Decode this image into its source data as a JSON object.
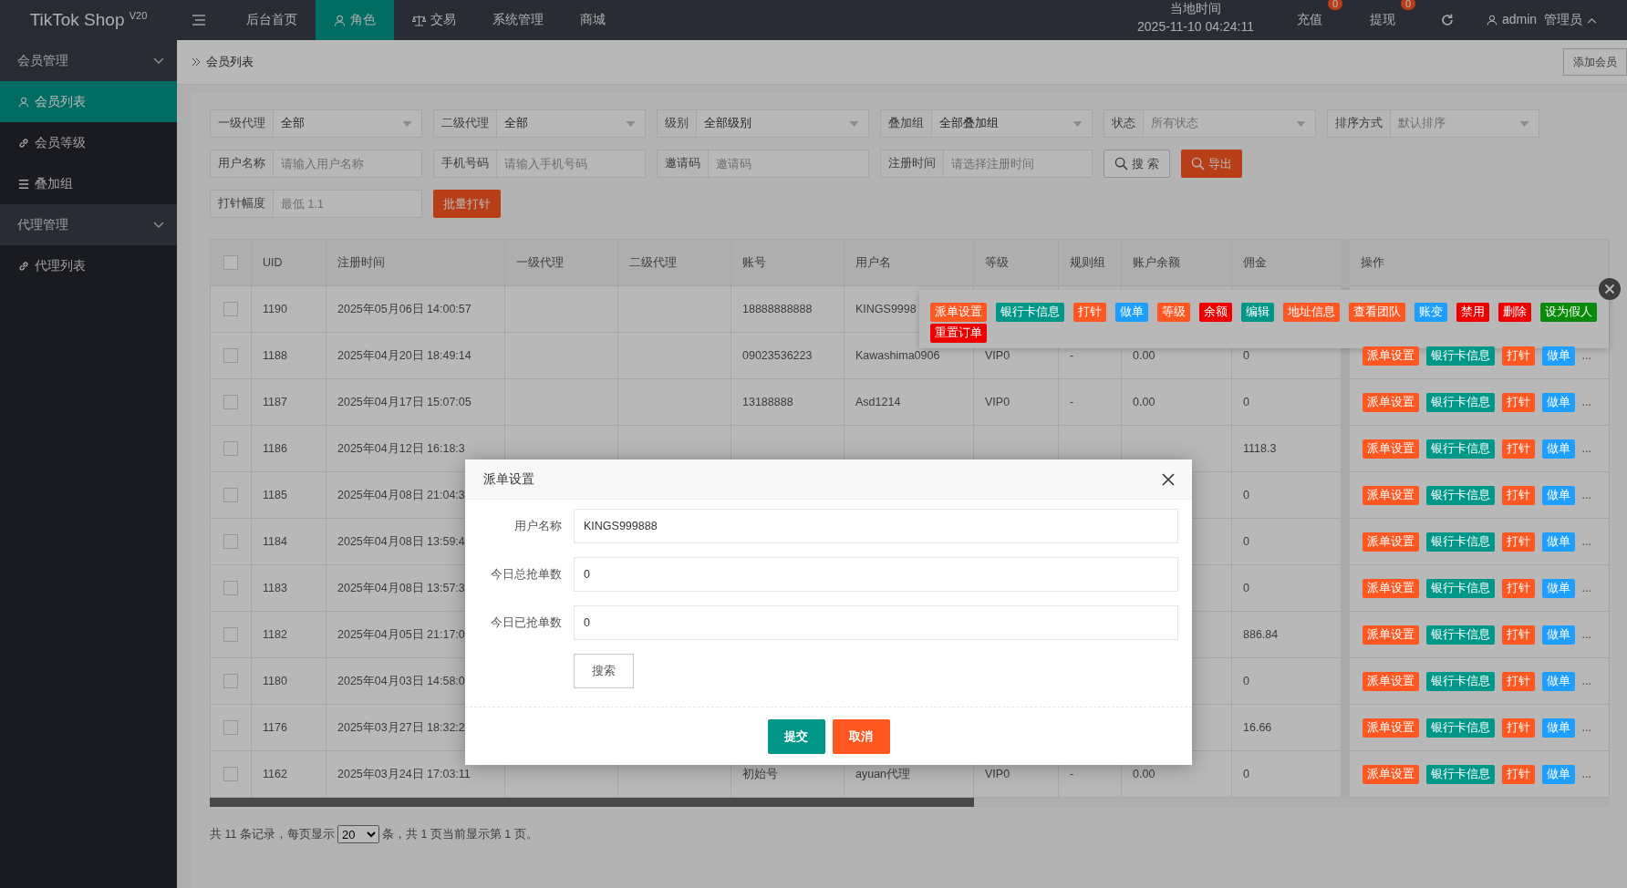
{
  "app": {
    "logo": "TikTok Shop $^{V20}$"
  },
  "top_nav": [
    {
      "label": "后台首页",
      "selected": false
    },
    {
      "label": "角色",
      "selected": true
    },
    {
      "label": "交易",
      "selected": false
    },
    {
      "label": "系统管理",
      "selected": false
    },
    {
      "label": "商城",
      "selected": false
    }
  ],
  "clock": {
    "label": "当地时间",
    "value": "2025-11-10 04:24:11"
  },
  "header_links": [
    {
      "label": "充值",
      "badge": "0"
    },
    {
      "label": "提现",
      "badge": "0"
    }
  ],
  "user": {
    "name": "admin",
    "role": "管理员"
  },
  "sidebar": {
    "groups": [
      {
        "label": "会员管理",
        "expanded": true,
        "children": [
          {
            "label": "会员列表",
            "selected": true
          },
          {
            "label": "会员等级",
            "selected": false
          },
          {
            "label": "叠加组",
            "selected": false
          }
        ]
      },
      {
        "label": "代理管理",
        "expanded": true,
        "children": [
          {
            "label": "代理列表",
            "selected": false
          }
        ]
      }
    ]
  },
  "breadcrumb": "会员列表",
  "add_button": "添加会员",
  "filter_rows": [
    {
      "fields": [
        {
          "label": "一级代理",
          "kind": "select",
          "value": "全部"
        },
        {
          "label": "二级代理",
          "kind": "select",
          "value": "全部"
        },
        {
          "label": "级别",
          "kind": "select",
          "value": "全部级别"
        },
        {
          "label": "叠加组",
          "kind": "select",
          "value": "全部叠加组"
        },
        {
          "label": "状态",
          "kind": "select",
          "placeholder": "所有状态"
        },
        {
          "label": "排序方式",
          "kind": "select",
          "placeholder": "默认排序"
        }
      ]
    },
    {
      "fields": [
        {
          "label": "用户名称",
          "kind": "input",
          "placeholder": "请输入用户名称"
        },
        {
          "label": "手机号码",
          "kind": "input",
          "placeholder": "请输入手机号码"
        },
        {
          "label": "邀请码",
          "kind": "input",
          "placeholder": "邀请码"
        },
        {
          "label": "注册时间",
          "kind": "input",
          "placeholder": "请选择注册时间"
        }
      ],
      "buttons": [
        {
          "label": "搜 索",
          "kind": "outline"
        },
        {
          "label": "导出",
          "kind": "danger"
        }
      ]
    },
    {
      "fields": [
        {
          "label": "打针幅度",
          "kind": "input",
          "placeholder": "最低 1.1"
        }
      ],
      "buttons": [
        {
          "label": "批量打针",
          "kind": "danger"
        }
      ]
    }
  ],
  "table": {
    "select_all": {
      "checked": false
    },
    "columns": [
      "UID",
      "注册时间",
      "一级代理",
      "二级代理",
      "账号",
      "用户名",
      "等级",
      "规则组",
      "账户余额",
      "佣金",
      "操作"
    ],
    "rows": [
      {
        "checked": false,
        "cells": [
          "1190",
          "2025年05月06日 14:00:57",
          null,
          null,
          "18888888888",
          "KINGS9998",
          null,
          null,
          null,
          null
        ]
      },
      {
        "checked": false,
        "cells": [
          "1188",
          "2025年04月20日 18:49:14",
          null,
          null,
          "09023536223",
          "Kawashima0906",
          "VIP0",
          "-",
          "0.00",
          "0"
        ],
        "actions": [
          {
            "label": "派单设置",
            "color": "#ff5722"
          },
          {
            "label": "银行卡信息",
            "color": "#009688"
          },
          {
            "label": "打针",
            "color": "#ff5722"
          },
          {
            "label": "做单",
            "color": "#1e9fff"
          }
        ],
        "more": "..."
      },
      {
        "checked": false,
        "cells": [
          "1187",
          "2025年04月17日 15:07:05",
          null,
          null,
          "13188888",
          "Asd1214",
          "VIP0",
          "-",
          "0.00",
          "0"
        ],
        "actions": [
          {
            "label": "派单设置",
            "color": "#ff5722"
          },
          {
            "label": "银行卡信息",
            "color": "#009688"
          },
          {
            "label": "打针",
            "color": "#ff5722"
          },
          {
            "label": "做单",
            "color": "#1e9fff"
          }
        ],
        "more": "..."
      },
      {
        "checked": false,
        "cells": [
          "1186",
          "2025年04月12日 16:18:3",
          null,
          null,
          null,
          null,
          null,
          null,
          null,
          "1118.3"
        ],
        "actions": [
          {
            "label": "派单设置",
            "color": "#ff5722"
          },
          {
            "label": "银行卡信息",
            "color": "#009688"
          },
          {
            "label": "打针",
            "color": "#ff5722"
          },
          {
            "label": "做单",
            "color": "#1e9fff"
          }
        ],
        "more": "..."
      },
      {
        "checked": false,
        "cells": [
          "1185",
          "2025年04月08日 21:04:3",
          null,
          null,
          null,
          null,
          null,
          null,
          null,
          "0"
        ],
        "actions": [
          {
            "label": "派单设置",
            "color": "#ff5722"
          },
          {
            "label": "银行卡信息",
            "color": "#009688"
          },
          {
            "label": "打针",
            "color": "#ff5722"
          },
          {
            "label": "做单",
            "color": "#1e9fff"
          }
        ],
        "more": "..."
      },
      {
        "checked": false,
        "cells": [
          "1184",
          "2025年04月08日 13:59:4",
          null,
          null,
          null,
          null,
          null,
          null,
          null,
          "0"
        ],
        "actions": [
          {
            "label": "派单设置",
            "color": "#ff5722"
          },
          {
            "label": "银行卡信息",
            "color": "#009688"
          },
          {
            "label": "打针",
            "color": "#ff5722"
          },
          {
            "label": "做单",
            "color": "#1e9fff"
          }
        ],
        "more": "..."
      },
      {
        "checked": false,
        "cells": [
          "1183",
          "2025年04月08日 13:57:3",
          null,
          null,
          null,
          null,
          null,
          null,
          null,
          "0"
        ],
        "actions": [
          {
            "label": "派单设置",
            "color": "#ff5722"
          },
          {
            "label": "银行卡信息",
            "color": "#009688"
          },
          {
            "label": "打针",
            "color": "#ff5722"
          },
          {
            "label": "做单",
            "color": "#1e9fff"
          }
        ],
        "more": "..."
      },
      {
        "checked": false,
        "cells": [
          "1182",
          "2025年04月05日 21:17:0",
          null,
          null,
          null,
          null,
          null,
          null,
          null,
          "886.84"
        ],
        "actions": [
          {
            "label": "派单设置",
            "color": "#ff5722"
          },
          {
            "label": "银行卡信息",
            "color": "#009688"
          },
          {
            "label": "打针",
            "color": "#ff5722"
          },
          {
            "label": "做单",
            "color": "#1e9fff"
          }
        ],
        "more": "..."
      },
      {
        "checked": false,
        "cells": [
          "1180",
          "2025年04月03日 14:58:0",
          null,
          null,
          null,
          null,
          null,
          null,
          null,
          "0"
        ],
        "actions": [
          {
            "label": "派单设置",
            "color": "#ff5722"
          },
          {
            "label": "银行卡信息",
            "color": "#009688"
          },
          {
            "label": "打针",
            "color": "#ff5722"
          },
          {
            "label": "做单",
            "color": "#1e9fff"
          }
        ],
        "more": "..."
      },
      {
        "checked": false,
        "cells": [
          "1176",
          "2025年03月27日 18:32:2",
          null,
          null,
          null,
          null,
          null,
          null,
          null,
          "16.66"
        ],
        "actions": [
          {
            "label": "派单设置",
            "color": "#ff5722"
          },
          {
            "label": "银行卡信息",
            "color": "#009688"
          },
          {
            "label": "打针",
            "color": "#ff5722"
          },
          {
            "label": "做单",
            "color": "#1e9fff"
          }
        ],
        "more": "..."
      },
      {
        "checked": false,
        "cells": [
          "1162",
          "2025年03月24日 17:03:11",
          null,
          null,
          "初始号",
          "ayuan代理",
          "VIP0",
          "-",
          "0.00",
          "0"
        ],
        "actions": [
          {
            "label": "派单设置",
            "color": "#ff5722"
          },
          {
            "label": "银行卡信息",
            "color": "#009688"
          },
          {
            "label": "打针",
            "color": "#ff5722"
          },
          {
            "label": "做单",
            "color": "#1e9fff"
          }
        ],
        "more": "..."
      }
    ]
  },
  "action_popup": {
    "actions": [
      {
        "label": "派单设置",
        "color": "#ff5722"
      },
      {
        "label": "银行卡信息",
        "color": "#009688"
      },
      {
        "label": "打针",
        "color": "#ff5722"
      },
      {
        "label": "做单",
        "color": "#1e9fff"
      },
      {
        "label": "等级",
        "color": "#ff5722"
      },
      {
        "label": "余额",
        "color": "#ee0000"
      },
      {
        "label": "编辑",
        "color": "#009688"
      },
      {
        "label": "地址信息",
        "color": "#ff5722"
      },
      {
        "label": "查看团队",
        "color": "#ff5722"
      },
      {
        "label": "账变",
        "color": "#1e9fff"
      },
      {
        "label": "禁用",
        "color": "#ee0000"
      },
      {
        "label": "删除",
        "color": "#ee0000"
      },
      {
        "label": "设为假人",
        "color": "#0a8a0a"
      },
      {
        "label": "重置订单",
        "color": "#ee0000"
      }
    ]
  },
  "pagination": {
    "text_before": "共 11 条记录，每页显示",
    "page_size": "20",
    "text_after": "条，共 1 页当前显示第 1 页。"
  },
  "modal": {
    "title": "派单设置",
    "fields": [
      {
        "label": "用户名称",
        "value": "KINGS999888"
      },
      {
        "label": "今日总抢单数",
        "value": "0"
      },
      {
        "label": "今日已抢单数",
        "value": "0"
      }
    ],
    "search_button": "搜索",
    "submit": "提交",
    "cancel": "取消"
  }
}
